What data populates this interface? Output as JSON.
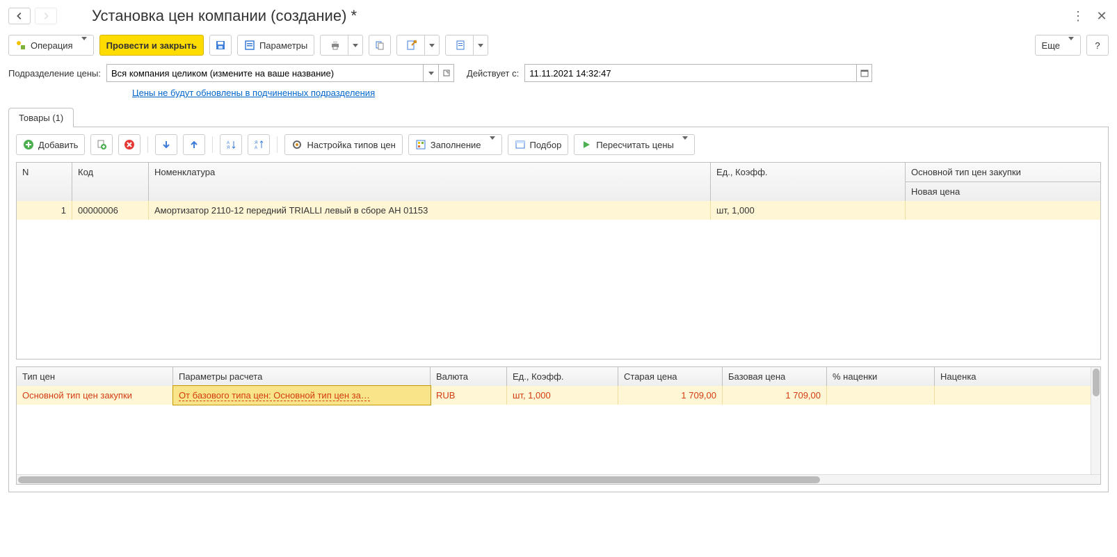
{
  "header": {
    "title": "Установка цен компании (создание) *"
  },
  "toolbar": {
    "operation": "Операция",
    "run_close": "Провести и закрыть",
    "params": "Параметры",
    "more": "Еще",
    "help": "?"
  },
  "form": {
    "division_label": "Подразделение цены:",
    "division_value": "Вся компания целиком (измените на ваше название)",
    "effective_label": "Действует с:",
    "effective_value": "11.11.2021 14:32:47",
    "note_link": "Цены не будут обновлены в подчиненных подразделения"
  },
  "tabs": {
    "goods": "Товары (1)"
  },
  "goods_toolbar": {
    "add": "Добавить",
    "configure": "Настройка типов цен",
    "fill": "Заполнение",
    "pick": "Подбор",
    "recalc": "Пересчитать цены"
  },
  "goods_table": {
    "headers": {
      "n": "N",
      "code": "Код",
      "name": "Номенклатура",
      "unit": "Ед., Коэфф.",
      "price_type": "Основной тип цен закупки",
      "new_price": "Новая цена"
    },
    "rows": [
      {
        "n": "1",
        "code": "00000006",
        "name": "Амортизатор 2110-12 передний TRIALLI левый в сборе AH 01153",
        "unit": "шт, 1,000",
        "new_price": ""
      }
    ]
  },
  "price_table": {
    "headers": {
      "type": "Тип цен",
      "params": "Параметры расчета",
      "currency": "Валюта",
      "unit": "Ед., Коэфф.",
      "old": "Старая цена",
      "base": "Базовая цена",
      "pct": "% наценки",
      "markup": "Наценка"
    },
    "rows": [
      {
        "type": "Основной тип цен закупки",
        "params": "От базового типа цен: Основной тип цен за…",
        "currency": "RUB",
        "unit": "шт, 1,000",
        "old": "1 709,00",
        "base": "1 709,00",
        "pct": "",
        "markup": ""
      }
    ]
  }
}
